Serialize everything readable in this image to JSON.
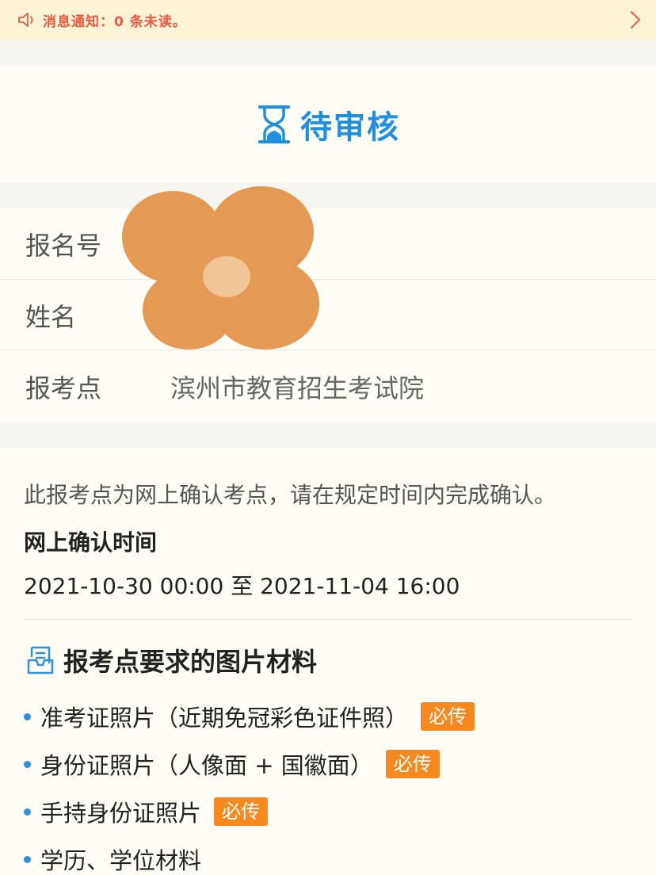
{
  "notice": {
    "icon": "speaker-icon",
    "text": "消息通知：0 条未读。",
    "chevron_icon": "chevron-right-icon"
  },
  "status": {
    "icon": "hourglass-icon",
    "title": "待审核",
    "color": "#1f8fe0"
  },
  "info": {
    "rows": [
      {
        "label": "报名号",
        "value": ""
      },
      {
        "label": "姓名",
        "value": ""
      },
      {
        "label": "报考点",
        "value": "滨州市教育招生考试院"
      }
    ]
  },
  "confirm": {
    "hint": "此报考点为网上确认考点，请在规定时间内完成确认。",
    "title": "网上确认时间",
    "time": "2021-10-30 00:00 至 2021-11-04 16:00"
  },
  "materials": {
    "icon": "document-icon",
    "title": "报考点要求的图片材料",
    "badge_color": "#f6891f",
    "items": [
      {
        "text": "准考证照片（近期免冠彩色证件照）",
        "badge": "必传"
      },
      {
        "text": "身份证照片（人像面 + 国徽面）",
        "badge": "必传"
      },
      {
        "text": "手持身份证照片",
        "badge": "必传"
      },
      {
        "text": "学历、学位材料",
        "badge": ""
      }
    ]
  }
}
